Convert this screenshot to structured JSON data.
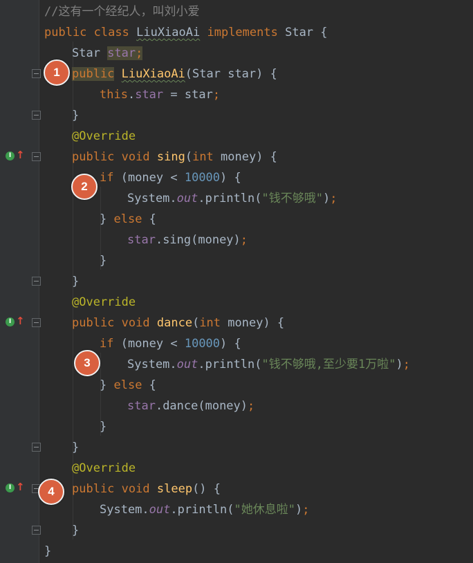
{
  "comment": "//这有一个经纪人，叫刘小爱",
  "class_decl": {
    "kw_public": "public",
    "kw_class": "class",
    "name": "LiuXiaoAi",
    "kw_implements": "implements",
    "iface": "Star",
    "brace": "{"
  },
  "field_decl": {
    "type": "Star",
    "name": "star",
    "semi": ";"
  },
  "ctor": {
    "kw_public": "public",
    "name": "LiuXiaoAi",
    "params": "(Star star) {"
  },
  "ctor_body": {
    "kw_this": "this",
    "dot": ".",
    "field": "star",
    "assign": " = star",
    "semi": ";"
  },
  "close_brace": "}",
  "annotation": "@Override",
  "sing": {
    "kw_public": "public",
    "kw_void": "void",
    "name": "sing",
    "params_open": "(",
    "kw_int": "int",
    "params_rest": " money) {"
  },
  "sing_if": {
    "kw_if": "if",
    "cond_a": " (money < ",
    "num": "10000",
    "cond_b": ") {"
  },
  "sing_print": {
    "cls": "System",
    "dot1": ".",
    "out": "out",
    "dot2": ".println(",
    "str": "\"钱不够哦\"",
    "close": ")",
    "semi": ";"
  },
  "else_line": {
    "brace": "} ",
    "kw_else": "else",
    "rest": " {"
  },
  "sing_call": {
    "field": "star",
    "rest": ".sing(money)",
    "semi": ";"
  },
  "dance": {
    "kw_public": "public",
    "kw_void": "void",
    "name": "dance",
    "params_open": "(",
    "kw_int": "int",
    "params_rest": " money) {"
  },
  "dance_print": {
    "cls": "System",
    "dot1": ".",
    "out": "out",
    "dot2": ".println(",
    "str": "\"钱不够哦,至少要1万啦\"",
    "close": ")",
    "semi": ";"
  },
  "dance_call": {
    "field": "star",
    "rest": ".dance(money)",
    "semi": ";"
  },
  "sleep": {
    "kw_public": "public",
    "kw_void": "void",
    "name": "sleep",
    "params": "() {"
  },
  "sleep_print": {
    "cls": "System",
    "dot1": ".",
    "out": "out",
    "dot2": ".println(",
    "str": "\"她休息啦\"",
    "close": ")",
    "semi": ";"
  },
  "markers": [
    "1",
    "2",
    "3",
    "4"
  ],
  "gutter_icon": {
    "letter": "I",
    "arrow": "↑",
    "name": "implements-method-icon"
  },
  "colors": {
    "background": "#2b2b2b",
    "keyword": "#cc7832",
    "function": "#ffc66d",
    "annotation": "#bbb529",
    "number": "#6897bb",
    "string": "#6a8759",
    "field": "#9876aa",
    "comment": "#808080",
    "marker": "#d9603f"
  }
}
